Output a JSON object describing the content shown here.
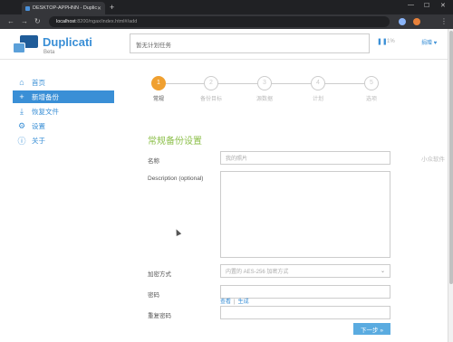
{
  "browser": {
    "tab_title": "DESKTOP-APPHNN - Duplicati",
    "url_host": "localhost",
    "url_path": ":8200/ngax/index.html#/add"
  },
  "header": {
    "brand": "Duplicati",
    "brand_sub": "Beta",
    "status_text": "暂无计划任务",
    "pause_icon": "pause-icon",
    "speed_text": "1%",
    "donate_label": "捐赠 ♥"
  },
  "sidebar": {
    "items": [
      {
        "label": "首页",
        "icon": "home-icon",
        "glyph": "⌂",
        "active": false
      },
      {
        "label": "新增备份",
        "icon": "plus-icon",
        "glyph": "+",
        "active": true
      },
      {
        "label": "恢复文件",
        "icon": "restore-icon",
        "glyph": "⤓",
        "active": false
      },
      {
        "label": "设置",
        "icon": "gear-icon",
        "glyph": "⚙",
        "active": false
      },
      {
        "label": "关于",
        "icon": "info-icon",
        "glyph": "ⓘ",
        "active": false
      }
    ]
  },
  "steps": [
    {
      "num": "1",
      "label": "常规",
      "active": true
    },
    {
      "num": "2",
      "label": "备份目标",
      "active": false
    },
    {
      "num": "3",
      "label": "源数据",
      "active": false
    },
    {
      "num": "4",
      "label": "计划",
      "active": false
    },
    {
      "num": "5",
      "label": "选项",
      "active": false
    }
  ],
  "form": {
    "section_title": "常规备份设置",
    "name_label": "名称",
    "name_placeholder": "我的照片",
    "description_label": "Description (optional)",
    "encryption_label": "加密方式",
    "encryption_value": "内置的 AES-256 加密方式",
    "password_label": "密码",
    "repeat_password_label": "重复密码",
    "show_link": "查看",
    "generate_link": "生成",
    "next_button": "下一步 »"
  },
  "watermark": "小众软件"
}
